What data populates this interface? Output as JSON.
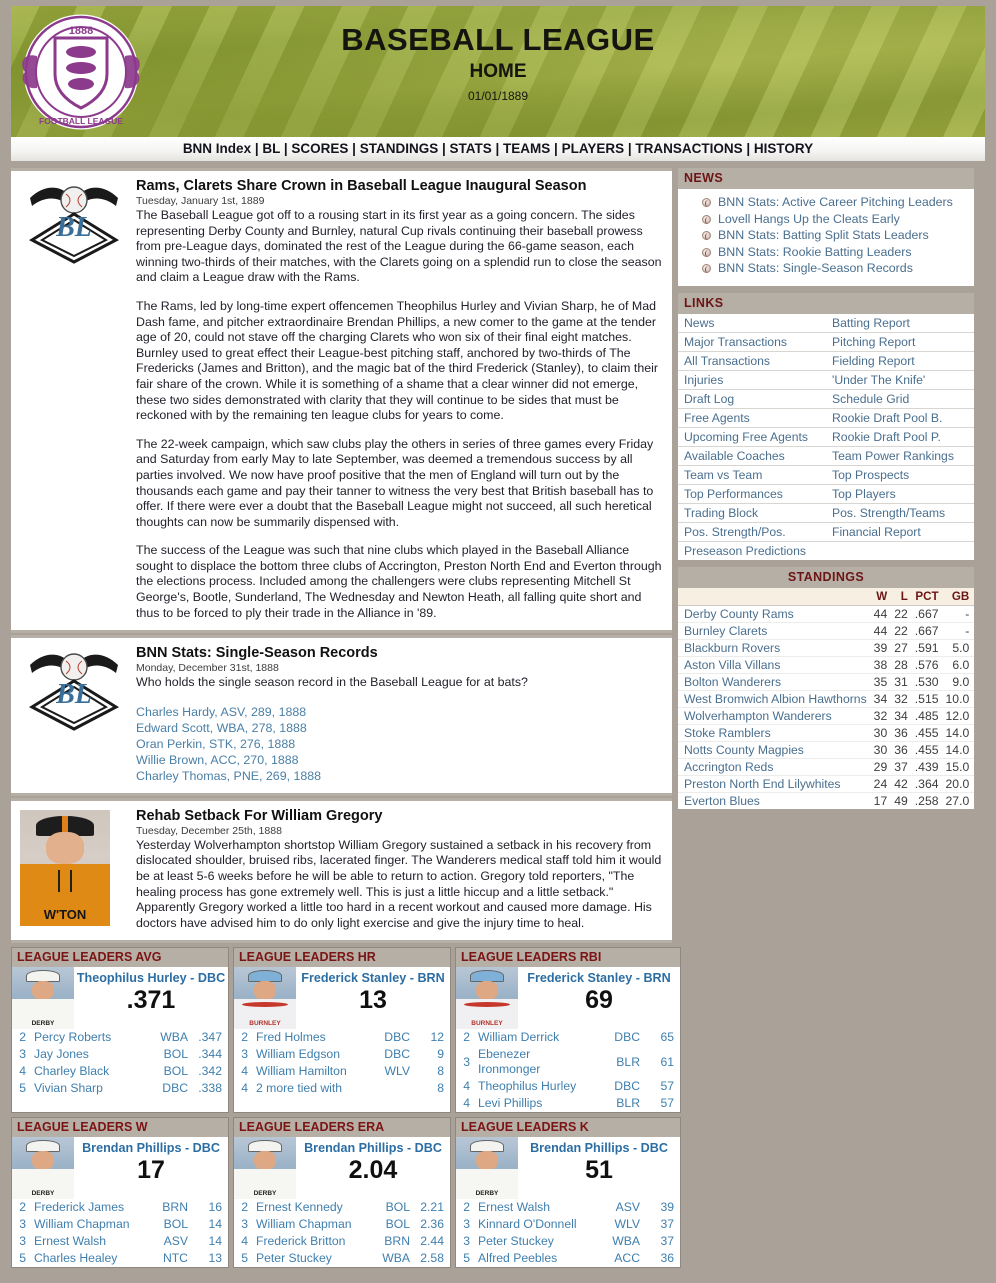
{
  "header": {
    "crest_icon": "football-league-crest-icon",
    "title": "BASEBALL LEAGUE",
    "subtitle": "HOME",
    "date": "01/01/1889"
  },
  "nav": {
    "items": [
      "BNN Index",
      "BL",
      "SCORES",
      "STANDINGS",
      "STATS",
      "TEAMS",
      "PLAYERS",
      "TRANSACTIONS",
      "HISTORY"
    ],
    "separator": "|"
  },
  "articles": [
    {
      "icon": "baseball-league-diamond-icon",
      "title": "Rams, Clarets Share Crown in Baseball League Inaugural Season",
      "date": "Tuesday, January 1st, 1889",
      "paragraphs": [
        "The Baseball League got off to a rousing start in its first year as a going concern. The sides representing Derby County and Burnley, natural Cup rivals continuing their baseball prowess from pre-League days, dominated the rest of the League during the 66-game season, each winning two-thirds of their matches, with the Clarets going on a splendid run to close the season and claim a League draw with the Rams.",
        "The Rams, led by long-time expert offencemen Theophilus Hurley and Vivian Sharp, he of Mad Dash fame, and pitcher extraordinaire Brendan Phillips, a new comer to the game at the tender age of 20, could not stave off the charging Clarets who won six of their final eight matches. Burnley used to great effect their League-best pitching staff, anchored by two-thirds of The Fredericks (James and Britton), and the magic bat of the third Frederick (Stanley), to claim their fair share of the crown. While it is something of a shame that a clear winner did not emerge, these two sides demonstrated with clarity that they will continue to be sides that must be reckoned with by the remaining ten league clubs for years to come.",
        "The 22-week campaign, which saw clubs play the others in series of three games every Friday and Saturday from early May to late September, was deemed a tremendous success by all parties involved. We now have proof positive that the men of England will turn out by the thousands each game and pay their tanner to witness the very best that British baseball has to offer. If there were ever a doubt that the Baseball League might not succeed, all such heretical thoughts can now be summarily dispensed with.",
        "The success of the League was such that nine clubs which played in the Baseball Alliance sought to displace the bottom three clubs of Accrington, Preston North End and Everton through the elections process. Included among the challengers were clubs representing Mitchell St George's, Bootle, Sunderland, The Wednesday and Newton Heath, all falling quite short and thus to be forced to ply their trade in the Alliance in '89."
      ]
    },
    {
      "icon": "baseball-league-diamond-icon",
      "title": "BNN Stats: Single-Season Records",
      "date": "Monday, December 31st, 1888",
      "question": "Who holds the single season record in the Baseball League for at bats?",
      "records": [
        "Charles Hardy, ASV, 289, 1888",
        "Edward Scott, WBA, 278, 1888",
        "Oran Perkin, STK, 276, 1888",
        "Willie Brown, ACC, 270, 1888",
        "Charley Thomas, PNE, 269, 1888"
      ]
    },
    {
      "icon": "player-photo",
      "jersey_text": "W'TON",
      "title": "Rehab Setback For William Gregory",
      "date": "Tuesday, December 25th, 1888",
      "body": "Yesterday Wolverhampton shortstop William Gregory sustained a setback in his recovery from dislocated shoulder, bruised ribs, lacerated finger. The Wanderers medical staff told him it would be at least 5-6 weeks before he will be able to return to action. Gregory told reporters, \"The healing process has gone extremely well. This is just a little hiccup and a little setback.\" Apparently Gregory worked a little too hard in a recent workout and caused more damage. His doctors have advised him to do only light exercise and give the injury time to heal."
    }
  ],
  "news": {
    "heading": "NEWS",
    "items": [
      "BNN Stats: Active Career Pitching Leaders",
      "Lovell Hangs Up the Cleats Early",
      "BNN Stats: Batting Split Stats Leaders",
      "BNN Stats: Rookie Batting Leaders",
      "BNN Stats: Single-Season Records"
    ]
  },
  "links": {
    "heading": "LINKS",
    "rows": [
      [
        "News",
        "Batting Report"
      ],
      [
        "Major Transactions",
        "Pitching Report"
      ],
      [
        "All Transactions",
        "Fielding Report"
      ],
      [
        "Injuries",
        "'Under The Knife'"
      ],
      [
        "Draft Log",
        "Schedule Grid"
      ],
      [
        "Free Agents",
        "Rookie Draft Pool B."
      ],
      [
        "Upcoming Free Agents",
        "Rookie Draft Pool P."
      ],
      [
        "Available Coaches",
        "Team Power Rankings"
      ],
      [
        "Team vs Team",
        "Top Prospects"
      ],
      [
        "Top Performances",
        "Top Players"
      ],
      [
        "Trading Block",
        "Pos. Strength/Teams"
      ],
      [
        "Pos. Strength/Pos.",
        "Financial Report"
      ],
      [
        "Preseason Predictions",
        ""
      ]
    ]
  },
  "standings": {
    "heading": "STANDINGS",
    "columns": [
      "",
      "W",
      "L",
      "PCT",
      "GB"
    ],
    "rows": [
      [
        "Derby County Rams",
        "44",
        "22",
        ".667",
        "-"
      ],
      [
        "Burnley Clarets",
        "44",
        "22",
        ".667",
        "-"
      ],
      [
        "Blackburn Rovers",
        "39",
        "27",
        ".591",
        "5.0"
      ],
      [
        "Aston Villa Villans",
        "38",
        "28",
        ".576",
        "6.0"
      ],
      [
        "Bolton Wanderers",
        "35",
        "31",
        ".530",
        "9.0"
      ],
      [
        "West Bromwich Albion Hawthorns",
        "34",
        "32",
        ".515",
        "10.0"
      ],
      [
        "Wolverhampton Wanderers",
        "32",
        "34",
        ".485",
        "12.0"
      ],
      [
        "Stoke Ramblers",
        "30",
        "36",
        ".455",
        "14.0"
      ],
      [
        "Notts County Magpies",
        "30",
        "36",
        ".455",
        "14.0"
      ],
      [
        "Accrington Reds",
        "29",
        "37",
        ".439",
        "15.0"
      ],
      [
        "Preston North End Lilywhites",
        "24",
        "42",
        ".364",
        "20.0"
      ],
      [
        "Everton Blues",
        "17",
        "49",
        ".258",
        "27.0"
      ]
    ]
  },
  "leaders": [
    {
      "heading": "LEAGUE LEADERS AVG",
      "thumb": "derby-player-thumb",
      "jersey_text": "DERBY",
      "jersey_style": "white",
      "leader_name": "Theophilus Hurley - DBC",
      "leader_value": ".371",
      "rows": [
        [
          "2",
          "Percy Roberts",
          "WBA",
          ".347"
        ],
        [
          "3",
          "Jay Jones",
          "BOL",
          ".344"
        ],
        [
          "4",
          "Charley Black",
          "BOL",
          ".342"
        ],
        [
          "5",
          "Vivian  Sharp",
          "DBC",
          ".338"
        ]
      ]
    },
    {
      "heading": "LEAGUE LEADERS HR",
      "thumb": "burnley-player-thumb",
      "jersey_text": "BURNLEY",
      "jersey_style": "burnley",
      "leader_name": "Frederick Stanley - BRN",
      "leader_value": "13",
      "rows": [
        [
          "2",
          "Fred Holmes",
          "DBC",
          "12"
        ],
        [
          "3",
          "William Edgson",
          "DBC",
          "9"
        ],
        [
          "4",
          "William Hamilton",
          "WLV",
          "8"
        ],
        [
          "4",
          "2 more tied with",
          "",
          "8"
        ]
      ]
    },
    {
      "heading": "LEAGUE LEADERS RBI",
      "thumb": "burnley-player-thumb",
      "jersey_text": "BURNLEY",
      "jersey_style": "burnley",
      "leader_name": "Frederick Stanley - BRN",
      "leader_value": "69",
      "rows": [
        [
          "2",
          "William Derrick",
          "DBC",
          "65"
        ],
        [
          "3",
          "Ebenezer Ironmonger",
          "BLR",
          "61"
        ],
        [
          "4",
          "Theophilus Hurley",
          "DBC",
          "57"
        ],
        [
          "4",
          "Levi Phillips",
          "BLR",
          "57"
        ]
      ]
    },
    {
      "heading": "LEAGUE LEADERS W",
      "thumb": "derby-player-thumb",
      "jersey_text": "DERBY",
      "jersey_style": "white",
      "leader_name": "Brendan Phillips - DBC",
      "leader_value": "17",
      "rows": [
        [
          "2",
          "Frederick James",
          "BRN",
          "16"
        ],
        [
          "3",
          "William Chapman",
          "BOL",
          "14"
        ],
        [
          "3",
          "Ernest Walsh",
          "ASV",
          "14"
        ],
        [
          "5",
          "Charles Healey",
          "NTC",
          "13"
        ]
      ]
    },
    {
      "heading": "LEAGUE LEADERS ERA",
      "thumb": "derby-player-thumb",
      "jersey_text": "DERBY",
      "jersey_style": "white",
      "leader_name": "Brendan Phillips - DBC",
      "leader_value": "2.04",
      "rows": [
        [
          "2",
          "Ernest Kennedy",
          "BOL",
          "2.21"
        ],
        [
          "3",
          "William Chapman",
          "BOL",
          "2.36"
        ],
        [
          "4",
          "Frederick Britton",
          "BRN",
          "2.44"
        ],
        [
          "5",
          "Peter Stuckey",
          "WBA",
          "2.58"
        ]
      ]
    },
    {
      "heading": "LEAGUE LEADERS K",
      "thumb": "derby-player-thumb",
      "jersey_text": "DERBY",
      "jersey_style": "white",
      "leader_name": "Brendan Phillips - DBC",
      "leader_value": "51",
      "rows": [
        [
          "2",
          "Ernest Walsh",
          "ASV",
          "39"
        ],
        [
          "3",
          "Kinnard O'Donnell",
          "WLV",
          "37"
        ],
        [
          "3",
          "Peter Stuckey",
          "WBA",
          "37"
        ],
        [
          "5",
          "Alfred Peebles",
          "ACC",
          "36"
        ]
      ]
    }
  ],
  "colors": {
    "page_background": "#aaa199",
    "panel_header_bg": "#b6afa6",
    "panel_header_text": "#7b1414",
    "link_blue": "#4a6f8f",
    "field_green": "#9fae3d",
    "crest_purple": "#8c3a8c"
  }
}
